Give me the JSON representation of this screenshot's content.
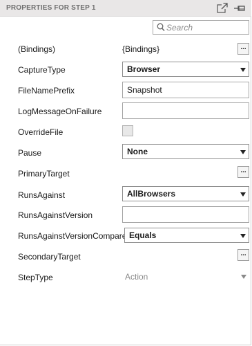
{
  "header": {
    "title": "PROPERTIES FOR STEP 1"
  },
  "search": {
    "placeholder": "Search"
  },
  "properties": {
    "bindings": {
      "label": "(Bindings)",
      "value": "{Bindings}",
      "button": "..."
    },
    "capture_type": {
      "label": "CaptureType",
      "value": "Browser"
    },
    "file_name_prefix": {
      "label": "FileNamePrefix",
      "value": "Snapshot"
    },
    "log_message_on_failure": {
      "label": "LogMessageOnFailure",
      "value": ""
    },
    "override_file": {
      "label": "OverrideFile",
      "checked": false
    },
    "pause": {
      "label": "Pause",
      "value": "None"
    },
    "primary_target": {
      "label": "PrimaryTarget",
      "button": "..."
    },
    "runs_against": {
      "label": "RunsAgainst",
      "value": "AllBrowsers"
    },
    "runs_against_version": {
      "label": "RunsAgainstVersion",
      "value": ""
    },
    "runs_against_version_compare": {
      "label": "RunsAgainstVersionCompare",
      "value": "Equals"
    },
    "secondary_target": {
      "label": "SecondaryTarget",
      "button": "..."
    },
    "step_type": {
      "label": "StepType",
      "value": "Action"
    }
  },
  "colors": {
    "header_bg": "#e9e7e7",
    "header_text": "#6f6f6f",
    "disabled_text": "#8a8a8a"
  },
  "icons": [
    "popout-icon",
    "pin-icon",
    "search-icon",
    "dropdown-caret-icon"
  ]
}
